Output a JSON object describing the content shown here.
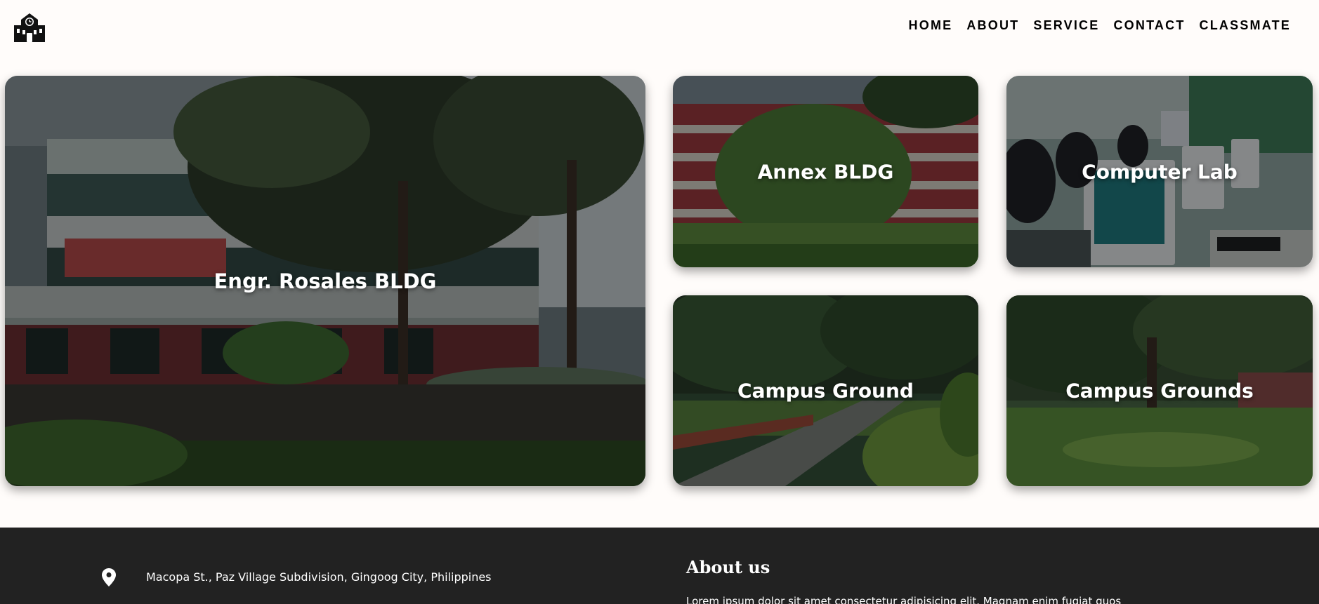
{
  "header": {
    "logo_icon": "school-building-icon",
    "nav": [
      {
        "label": "HOME"
      },
      {
        "label": "ABOUT"
      },
      {
        "label": "SERVICE"
      },
      {
        "label": "CONTACT"
      },
      {
        "label": "CLASSMATE"
      }
    ]
  },
  "gallery": {
    "tiles": [
      {
        "caption": "Engr. Rosales BLDG"
      },
      {
        "caption": "Annex BLDG"
      },
      {
        "caption": "Computer Lab"
      },
      {
        "caption": "Campus Ground"
      },
      {
        "caption": "Campus Grounds"
      }
    ]
  },
  "footer": {
    "address_icon": "map-pin-icon",
    "address": "Macopa St., Paz Village Subdivision, Gingoog City, Philippines",
    "about_title": "About us",
    "about_text": "Lorem ipsum dolor sit amet consectetur adipisicing elit. Magnam enim fugiat quos"
  },
  "colors": {
    "page_bg": "#fffcfa",
    "footer_bg": "#222222",
    "text_dark": "#000000",
    "text_light": "#ffffff"
  }
}
